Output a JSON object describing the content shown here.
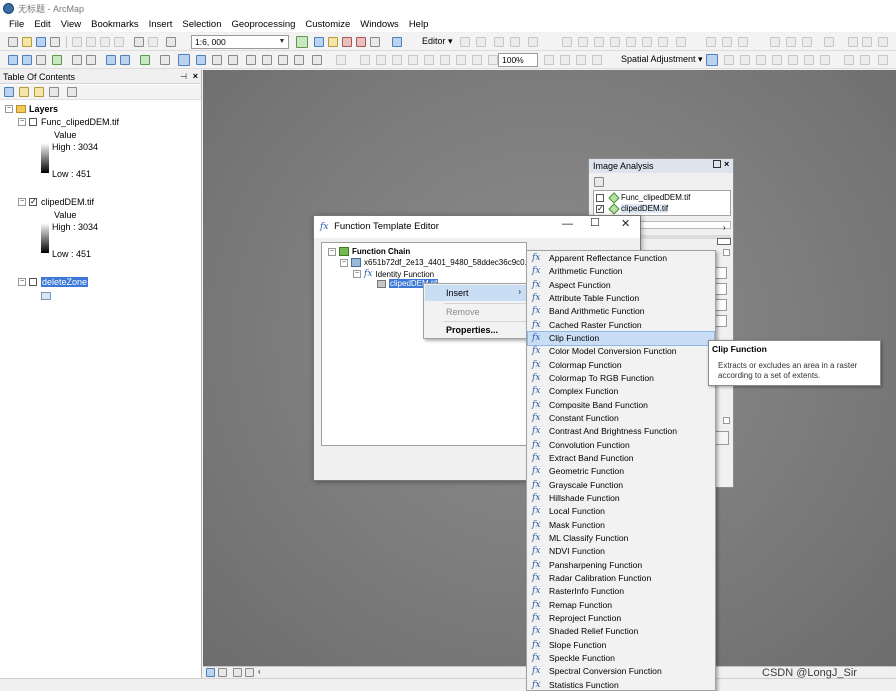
{
  "window": {
    "title": "无标题 - ArcMap"
  },
  "menu": [
    "File",
    "Edit",
    "View",
    "Bookmarks",
    "Insert",
    "Selection",
    "Geoprocessing",
    "Customize",
    "Windows",
    "Help"
  ],
  "toolbar": {
    "scale": "1:6, 000",
    "editor_label": "Editor ▾",
    "zoom_percent": "100%",
    "spatial_adjustment": "Spatial Adjustment ▾"
  },
  "toc": {
    "title": "Table Of Contents",
    "root": "Layers",
    "layers": [
      {
        "name": "Func_clipedDEM.tif",
        "checked": false,
        "legend_title": "Value",
        "high": "High : 3034",
        "low": "Low : 451"
      },
      {
        "name": "clipedDEM.tif",
        "checked": true,
        "legend_title": "Value",
        "high": "High : 3034",
        "low": "Low : 451"
      },
      {
        "name": "deleteZone",
        "checked": false
      }
    ]
  },
  "image_analysis": {
    "title": "Image Analysis",
    "layers": [
      "Func_clipedDEM.tif",
      "clipedDEM.tif"
    ]
  },
  "editor_dialog": {
    "title": "Function Template Editor",
    "tree": {
      "root": "Function Chain",
      "raster": "x651b72df_2e13_4401_9480_58ddec36c9c0.af",
      "function": "Identity Function",
      "leaf": "clipedDEM.tif"
    }
  },
  "context_menu": {
    "insert": "Insert",
    "remove": "Remove",
    "properties": "Properties..."
  },
  "functions": [
    "Apparent Reflectance Function",
    "Arithmetic Function",
    "Aspect Function",
    "Attribute Table Function",
    "Band Arithmetic Function",
    "Cached Raster Function",
    "Clip Function",
    "Color Model Conversion Function",
    "Colormap Function",
    "Colormap To RGB Function",
    "Complex Function",
    "Composite Band Function",
    "Constant Function",
    "Contrast And Brightness Function",
    "Convolution Function",
    "Extract Band Function",
    "Geometric Function",
    "Grayscale Function",
    "Hillshade Function",
    "Local Function",
    "Mask Function",
    "ML Classify Function",
    "NDVI Function",
    "Pansharpening Function",
    "Radar Calibration Function",
    "RasterInfo Function",
    "Remap Function",
    "Reproject Function",
    "Shaded Relief Function",
    "Slope Function",
    "Speckle Function",
    "Spectral Conversion Function",
    "Statistics Function"
  ],
  "highlighted_function": "Clip Function",
  "tooltip": {
    "title": "Clip Function",
    "description": "Extracts or excludes an area in a raster according to a set of extents."
  },
  "watermark": "CSDN @LongJ_Sir"
}
